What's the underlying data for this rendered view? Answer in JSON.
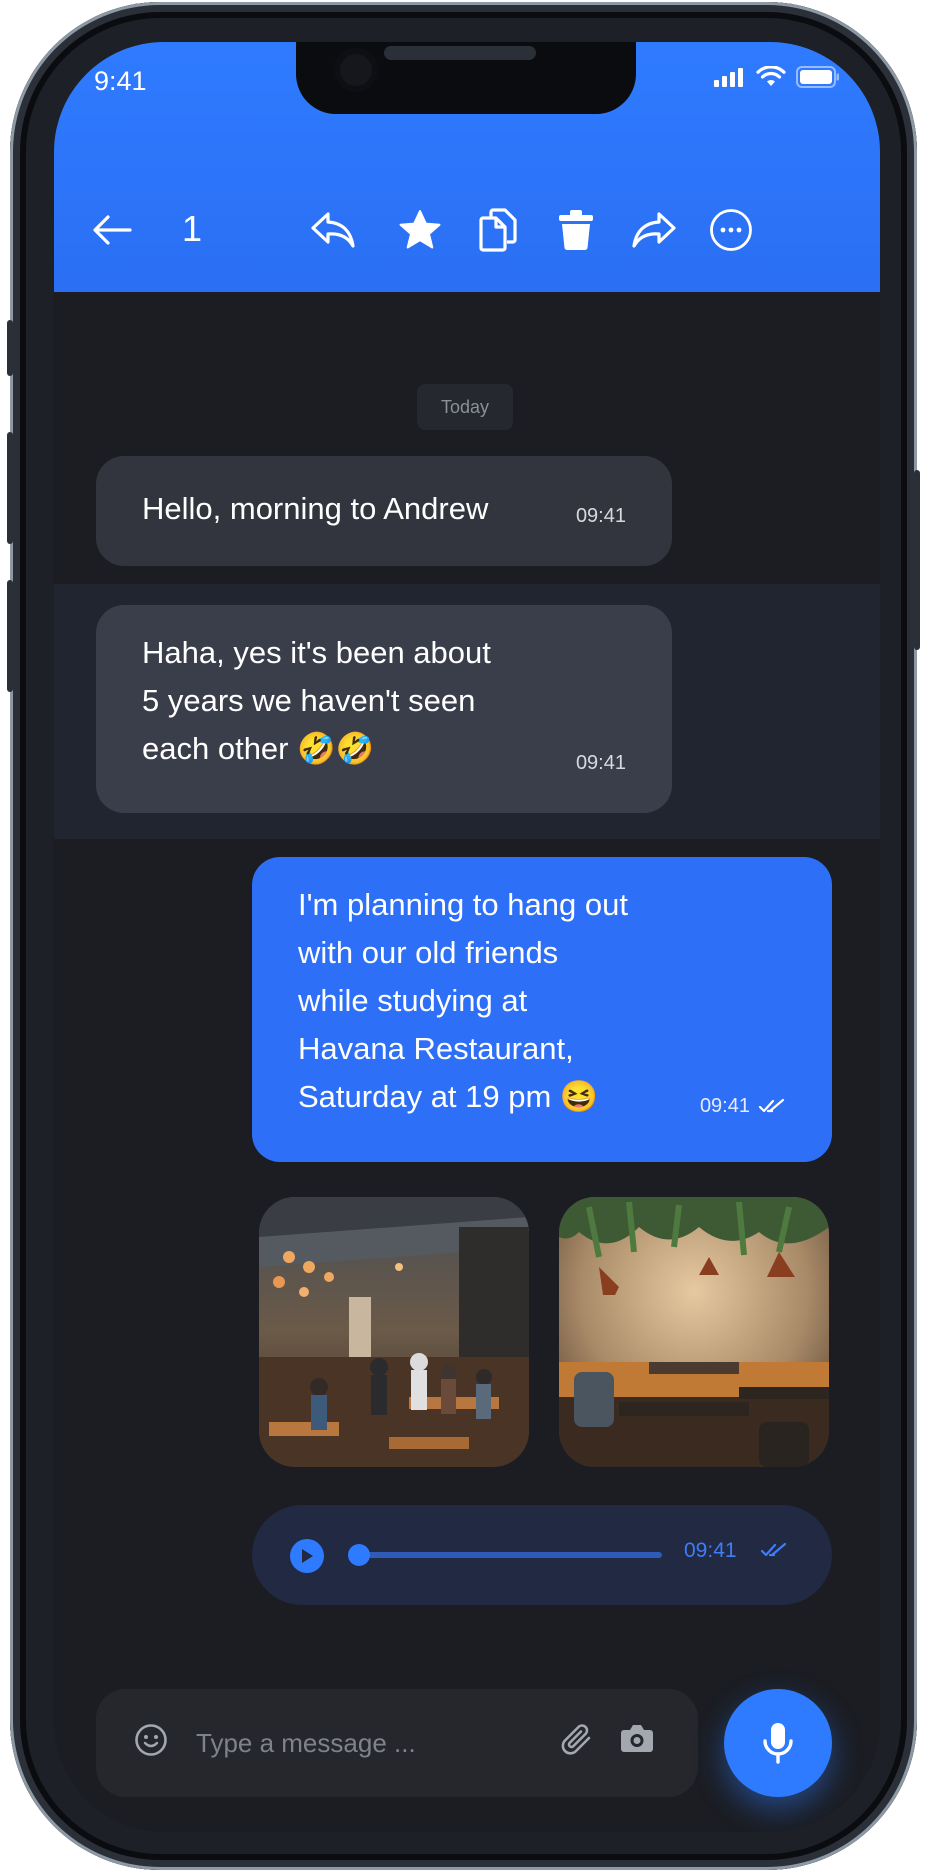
{
  "status_bar": {
    "time": "9:41"
  },
  "toolbar": {
    "selected_count": "1",
    "icons": [
      "back-arrow-icon",
      "reply-icon",
      "star-icon",
      "copy-icon",
      "trash-icon",
      "forward-icon",
      "more-icon"
    ]
  },
  "chat": {
    "date_separator": "Today",
    "messages": [
      {
        "direction": "incoming",
        "text": "Hello, morning to Andrew",
        "time": "09:41"
      },
      {
        "direction": "incoming",
        "selected": true,
        "lines": [
          "Haha, yes it's been about",
          "5 years we haven't seen",
          "each other 🤣🤣"
        ],
        "time": "09:41"
      },
      {
        "direction": "outgoing",
        "lines": [
          "I'm planning to hang out",
          "with our old friends",
          "while studying at",
          "Havana Restaurant,",
          "Saturday at 19 pm 😆"
        ],
        "time": "09:41",
        "status": "read"
      }
    ],
    "photos": [
      "restaurant-interior-photo",
      "restaurant-booth-photo"
    ],
    "voice_message": {
      "progress": 0.0,
      "time": "09:41",
      "status": "read"
    }
  },
  "composer": {
    "placeholder": "Type a message ..."
  },
  "colors": {
    "accent": "#2f7bff",
    "background": "#1b1d22",
    "incoming_bubble": "#32353d",
    "selected_bubble": "#3a3e4a"
  }
}
